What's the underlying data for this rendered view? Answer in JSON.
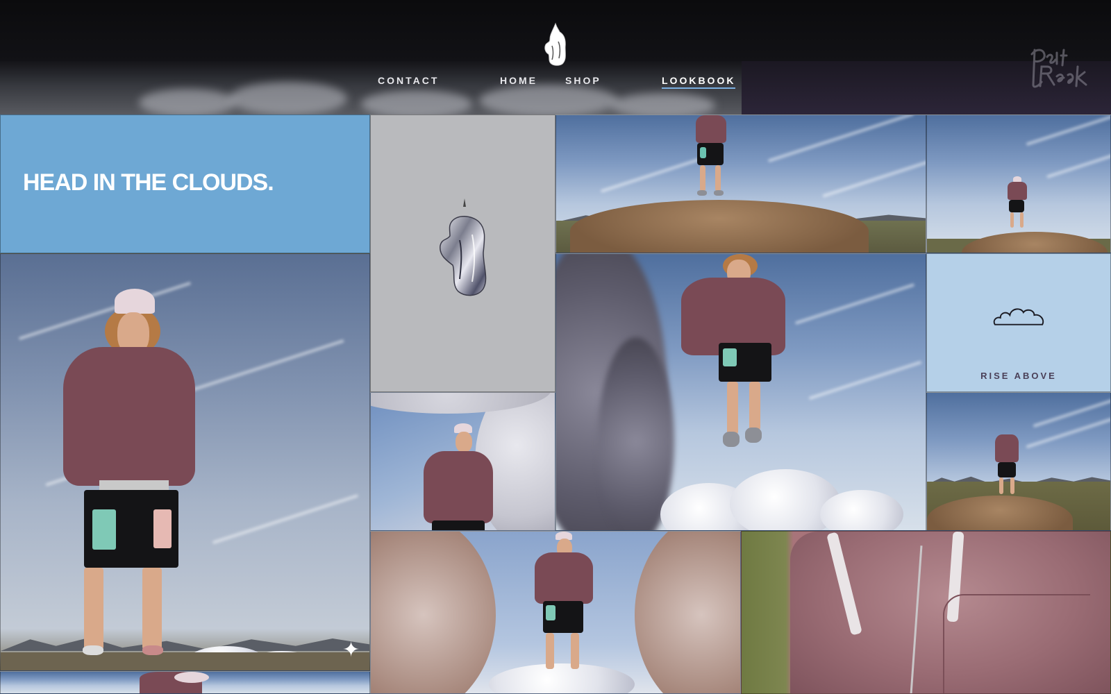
{
  "header": {
    "logo_icon": "drip-figure-logo-icon",
    "signature_icon": "brand-signature-logo",
    "nav": [
      {
        "label": "CONTACT",
        "active": false
      },
      {
        "label": "HOME",
        "active": false
      },
      {
        "label": "SHOP",
        "active": false
      },
      {
        "label": "LOOKBOOK",
        "active": true
      }
    ],
    "active_color": "#7aaee0"
  },
  "grid": {
    "headline": "HEAD IN THE CLOUDS.",
    "headline_bg": "#6ea8d4",
    "rise_label": "RISE ABOVE",
    "rise_bg": "#b5d0e8",
    "rise_icon": "cloud-outline-icon",
    "chrome_icon": "chrome-drip-figure-icon",
    "sparkle_icon": "sparkle-star-icon"
  }
}
